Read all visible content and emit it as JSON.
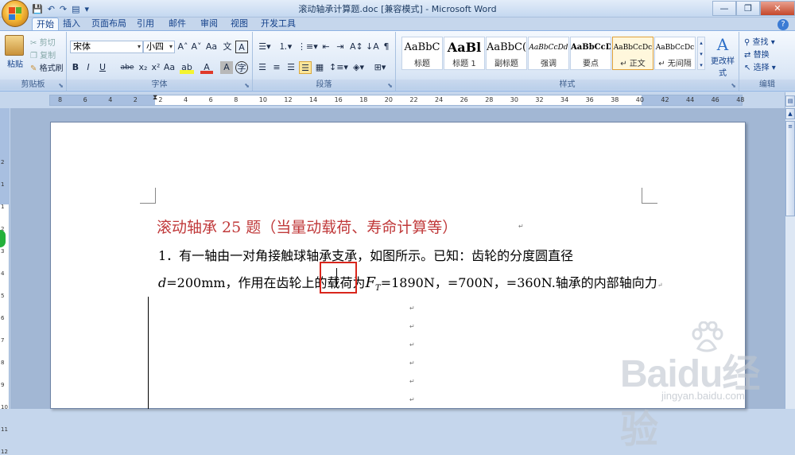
{
  "window": {
    "title": "滚动轴承计算题.doc [兼容模式] - Microsoft Word",
    "controls": {
      "minimize": "—",
      "maximize": "❐",
      "close": "✕"
    }
  },
  "quick_access": {
    "save": "💾",
    "undo": "↶",
    "redo": "↷",
    "print": "▤",
    "more": "▾"
  },
  "tabs": [
    "开始",
    "插入",
    "页面布局",
    "引用",
    "邮件",
    "审阅",
    "视图",
    "开发工具"
  ],
  "active_tab": "开始",
  "ribbon": {
    "clipboard": {
      "label": "剪贴板",
      "paste": "粘贴",
      "cut": "剪切",
      "copy": "复制",
      "format_painter": "格式刷"
    },
    "font": {
      "label": "字体",
      "font_name": "宋体",
      "font_size": "小四",
      "grow": "A˄",
      "shrink": "A˅",
      "clear": "Aa",
      "phonetic": "文",
      "border": "A",
      "bold": "B",
      "italic": "I",
      "underline": "U",
      "strike": "abe",
      "subscript": "x₂",
      "superscript": "x²",
      "case": "Aa",
      "highlight": "ab",
      "color": "A",
      "shade": "A",
      "enclose": "字"
    },
    "paragraph": {
      "label": "段落"
    },
    "styles": {
      "label": "样式",
      "items": [
        {
          "sample": "AaBbC",
          "name": "标题"
        },
        {
          "sample": "AaBl",
          "name": "标题 1"
        },
        {
          "sample": "AaBbC(",
          "name": "副标题"
        },
        {
          "sample": "AaBbCcDd",
          "name": "强调"
        },
        {
          "sample": "AaBbCcD",
          "name": "要点"
        },
        {
          "sample": "AaBbCcDc",
          "name": "↵ 正文"
        },
        {
          "sample": "AaBbCcDc",
          "name": "↵ 无间隔"
        }
      ],
      "change_styles": "更改样式"
    },
    "editing": {
      "label": "编辑",
      "find": "查找",
      "replace": "替换",
      "select": "选择"
    }
  },
  "ruler": {
    "ticks": [
      "8",
      "6",
      "4",
      "2",
      "2",
      "4",
      "6",
      "8",
      "10",
      "12",
      "14",
      "16",
      "18",
      "20",
      "22",
      "24",
      "26",
      "28",
      "30",
      "32",
      "34",
      "36",
      "38",
      "40",
      "42",
      "44",
      "46",
      "48"
    ]
  },
  "vruler": {
    "ticks": [
      "2",
      "1",
      "1",
      "2",
      "3",
      "4",
      "5",
      "6",
      "7",
      "8",
      "9",
      "10",
      "11",
      "12"
    ]
  },
  "document": {
    "heading": "滚动轴承 25 题（当量动载荷、寿命计算等）",
    "line1": "1．有一轴由一对角接触球轴承支承，如图所示。已知：齿轮的分度圆直径",
    "line2_d": "d",
    "line2_a": "=200mm，作用在齿轮上的载荷为",
    "line2_F": "F",
    "line2_T": "T",
    "line2_b": "=1890N，=700N，=360N.轴承的内部轴向力",
    "para_mark": "↵"
  },
  "watermark": {
    "brand": "Baidu经验",
    "url": "jingyan.baidu.com"
  }
}
